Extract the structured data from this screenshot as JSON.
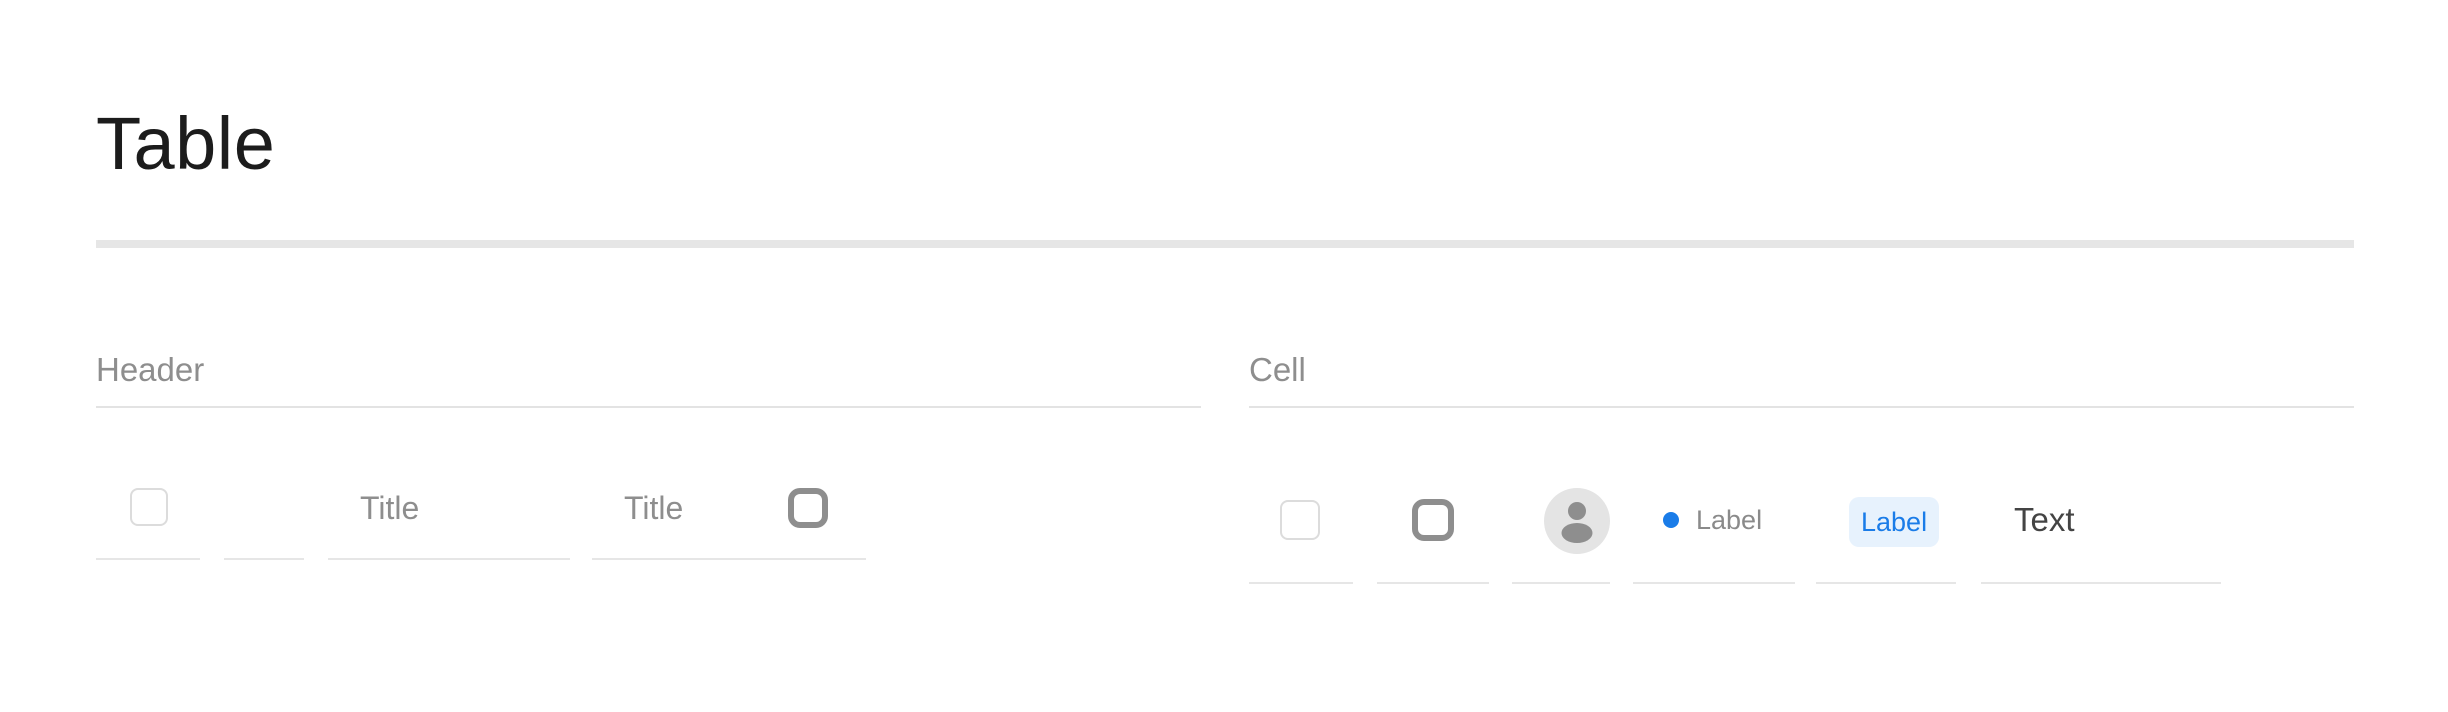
{
  "page": {
    "title": "Table"
  },
  "sections": {
    "header": {
      "label": "Header",
      "titles": [
        "Title",
        "Title"
      ]
    },
    "cell": {
      "label": "Cell",
      "status_label": "Label",
      "tag_label": "Label",
      "text": "Text"
    }
  },
  "colors": {
    "accent": "#1a7ce8",
    "tag_background": "#e7f2fd",
    "muted_text": "#8e8e8e",
    "divider": "#e6e6e6"
  },
  "icons": {
    "avatar": "user-avatar-icon",
    "status_dot": "status-dot-icon"
  }
}
